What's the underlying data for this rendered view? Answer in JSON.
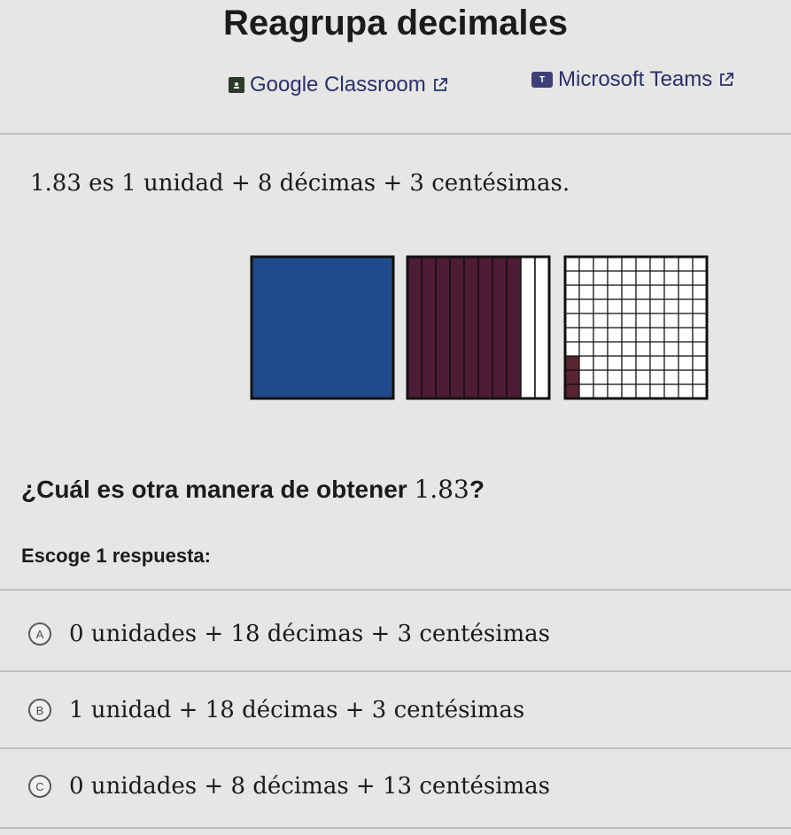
{
  "exercise": {
    "title": "Reagrupa decimales"
  },
  "share": {
    "google_classroom": "Google Classroom",
    "microsoft_teams": "Microsoft Teams",
    "google_icon": "google-classroom-icon",
    "teams_icon": "microsoft-teams-icon",
    "teams_icon_letter": "T",
    "external_icon": "external-link-icon"
  },
  "statement": "1.83 es 1 unidad + 8 décimas + 3 centésimas.",
  "models": {
    "whole_color": "#1f4b8c",
    "tenths_color": "#4e1c35",
    "hundredths_color": "#5a2530",
    "ones_shaded": 1,
    "tenths_shaded": 8,
    "tenths_total": 10,
    "hundredths_shaded": 3,
    "hundredths_total": 100
  },
  "question": {
    "text": "¿Cuál es otra manera de obtener ",
    "number": "1.83",
    "end": "?"
  },
  "prompt": "Escoge 1 respuesta:",
  "choices": [
    {
      "letter": "A",
      "text": "0 unidades + 18 décimas + 3 centésimas"
    },
    {
      "letter": "B",
      "text": "1 unidad + 18 décimas + 3 centésimas"
    },
    {
      "letter": "C",
      "text": "0 unidades + 8 décimas + 13 centésimas"
    }
  ]
}
